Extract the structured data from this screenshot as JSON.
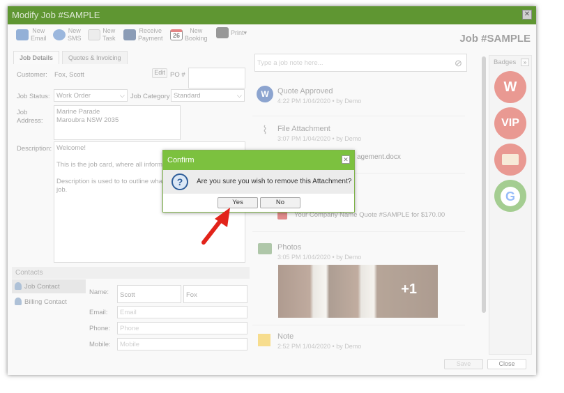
{
  "window": {
    "title": "Modify Job #SAMPLE",
    "job_title": "Job #SAMPLE"
  },
  "toolbar": [
    {
      "label": "New\nEmail",
      "icon": "email-icon",
      "color": "#3b6fb6"
    },
    {
      "label": "New\nSMS",
      "icon": "sms-icon",
      "color": "#3b6fb6"
    },
    {
      "label": "New\nTask",
      "icon": "task-icon",
      "color": "#9a9a9a"
    },
    {
      "label": "Receive\nPayment",
      "icon": "payment-icon",
      "color": "#2c4b7a"
    },
    {
      "label": "New\nBooking",
      "icon": "calendar-icon",
      "color": "#c22"
    },
    {
      "label": "Print",
      "icon": "printer-icon",
      "color": "#333"
    }
  ],
  "tabs": [
    "Job Details",
    "Quotes & Invoicing"
  ],
  "form": {
    "customer_label": "Customer:",
    "customer": "Fox, Scott",
    "edit": "Edit",
    "po_label": "PO #",
    "status_label": "Job Status:",
    "status": "Work Order",
    "category_label": "Job Category",
    "category": "Standard",
    "address_label": "Job\nAddress:",
    "address": "Marine Parade\nMaroubra NSW 2035",
    "desc_label": "Description:",
    "desc": "Welcome!\n\nThis is the job card, where all inform\n\nDescription is used to to outline wha\njob."
  },
  "contacts": {
    "title": "Contacts",
    "items": [
      "Job Contact",
      "Billing Contact"
    ],
    "name_label": "Name:",
    "first": "Scott",
    "last": "Fox",
    "email_label": "Email:",
    "email_ph": "Email",
    "phone_label": "Phone:",
    "phone_ph": "Phone",
    "mobile_label": "Mobile:",
    "mobile_ph": "Mobile"
  },
  "feed": {
    "note_placeholder": "Type a job note here...",
    "entries": [
      {
        "title": "Quote Approved",
        "meta": "4:22 PM 1/04/2020 •  by Demo"
      },
      {
        "title": "File Attachment",
        "meta": "3:07 PM 1/04/2020 •  by Demo",
        "file": "agement.docx"
      },
      {
        "title": "",
        "meta": "",
        "file": "Your Company Name Quote #SAMPLE for $170.00"
      },
      {
        "title": "Photos",
        "meta": "3:05 PM 1/04/2020 •  by Demo",
        "more": "+1"
      },
      {
        "title": "Note",
        "meta": "2:52 PM 1/04/2020 •  by Demo"
      }
    ]
  },
  "badges": {
    "title": "Badges",
    "items": [
      "W",
      "VIP",
      "card-icon",
      "google-icon"
    ]
  },
  "footer": {
    "save": "Save",
    "close": "Close"
  },
  "dialog": {
    "title": "Confirm",
    "message": "Are you sure you wish to remove this Attachment?",
    "yes": "Yes",
    "no": "No"
  }
}
